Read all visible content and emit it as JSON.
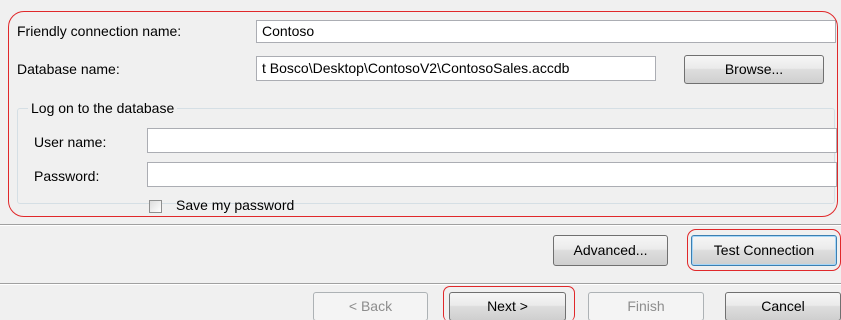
{
  "form": {
    "friendly_name_label": "Friendly connection name:",
    "friendly_name_value": "Contoso",
    "database_name_label": "Database name:",
    "database_name_value": "t Bosco\\Desktop\\ContosoV2\\ContosoSales.accdb",
    "browse_label": "Browse...",
    "group_title": "Log on to the database",
    "user_name_label": "User name:",
    "user_name_value": "",
    "password_label": "Password:",
    "password_value": "",
    "save_password_label": "Save my password",
    "save_password_checked": false
  },
  "actions": {
    "advanced_label": "Advanced...",
    "test_connection_label": "Test Connection"
  },
  "wizard": {
    "back_label": "< Back",
    "next_label": "Next >",
    "finish_label": "Finish",
    "cancel_label": "Cancel"
  },
  "colors": {
    "highlight": "#e0282a",
    "window_bg": "#f0f0f0",
    "field_border": "#abadb3"
  }
}
